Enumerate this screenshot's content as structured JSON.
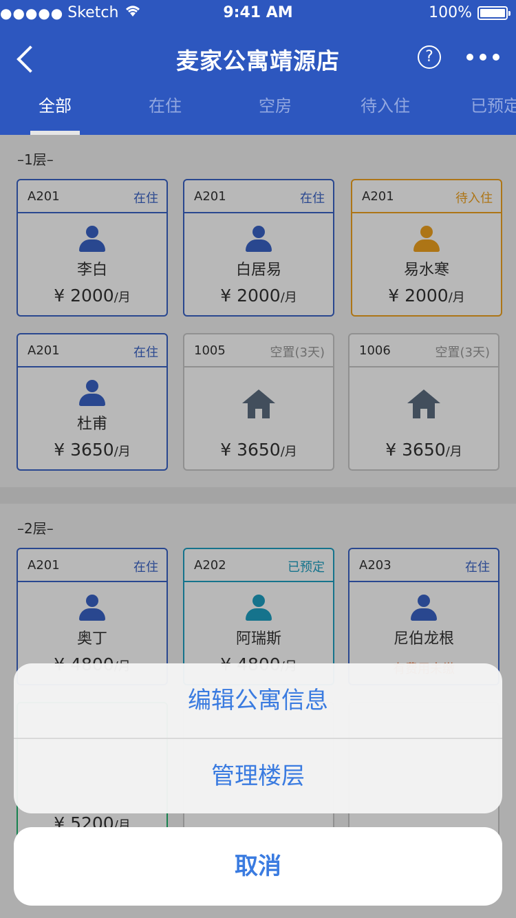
{
  "status_bar": {
    "signal": "●●●●●",
    "carrier": "Sketch",
    "time": "9:41 AM",
    "battery_text": "100%"
  },
  "nav": {
    "title": "麦家公寓靖源店",
    "help_symbol": "?"
  },
  "tabs": [
    {
      "label": "全部",
      "active": true
    },
    {
      "label": "在住",
      "active": false
    },
    {
      "label": "空房",
      "active": false
    },
    {
      "label": "待入住",
      "active": false
    },
    {
      "label": "已预定",
      "active": false
    }
  ],
  "floors": [
    {
      "label": "–1层–",
      "rooms": [
        {
          "room": "A201",
          "status": "在住",
          "name": "李白",
          "price": "¥ 2000",
          "unit": "/月",
          "color": "#3a63c7",
          "icon": "person-icon"
        },
        {
          "room": "A201",
          "status": "在住",
          "name": "白居易",
          "price": "¥ 2000",
          "unit": "/月",
          "color": "#3a63c7",
          "icon": "person-icon"
        },
        {
          "room": "A201",
          "status": "待入住",
          "name": "易水寒",
          "price": "¥ 2000",
          "unit": "/月",
          "color": "#f0a21f",
          "icon": "person-icon"
        },
        {
          "room": "A201",
          "status": "在住",
          "name": "杜甫",
          "price": "¥ 3650",
          "unit": "/月",
          "color": "#3a63c7",
          "icon": "person-icon"
        },
        {
          "room": "1005",
          "status": "空置(3天)",
          "name": "",
          "price": "¥ 3650",
          "unit": "/月",
          "color": "#5c6c80",
          "icon": "house-icon"
        },
        {
          "room": "1006",
          "status": "空置(3天)",
          "name": "",
          "price": "¥ 3650",
          "unit": "/月",
          "color": "#5c6c80",
          "icon": "house-icon"
        }
      ]
    },
    {
      "label": "–2层–",
      "rooms": [
        {
          "room": "A201",
          "status": "在住",
          "name": "奥丁",
          "price": "¥ 4800",
          "unit": "/月",
          "color": "#3a63c7",
          "icon": "person-icon"
        },
        {
          "room": "A202",
          "status": "已预定",
          "name": "阿瑞斯",
          "price": "¥ 4800",
          "unit": "/月",
          "color": "#1ea0c2",
          "icon": "person-icon"
        },
        {
          "room": "A203",
          "status": "在住",
          "name": "尼伯龙根",
          "note": "有费用未缴",
          "color": "#3a63c7",
          "icon": "person-icon"
        },
        {
          "price": "¥ 5200",
          "unit": "/月",
          "color": "#20b46e"
        }
      ]
    }
  ],
  "action_sheet": {
    "items": [
      "编辑公寓信息",
      "管理楼层"
    ],
    "cancel": "取消"
  }
}
